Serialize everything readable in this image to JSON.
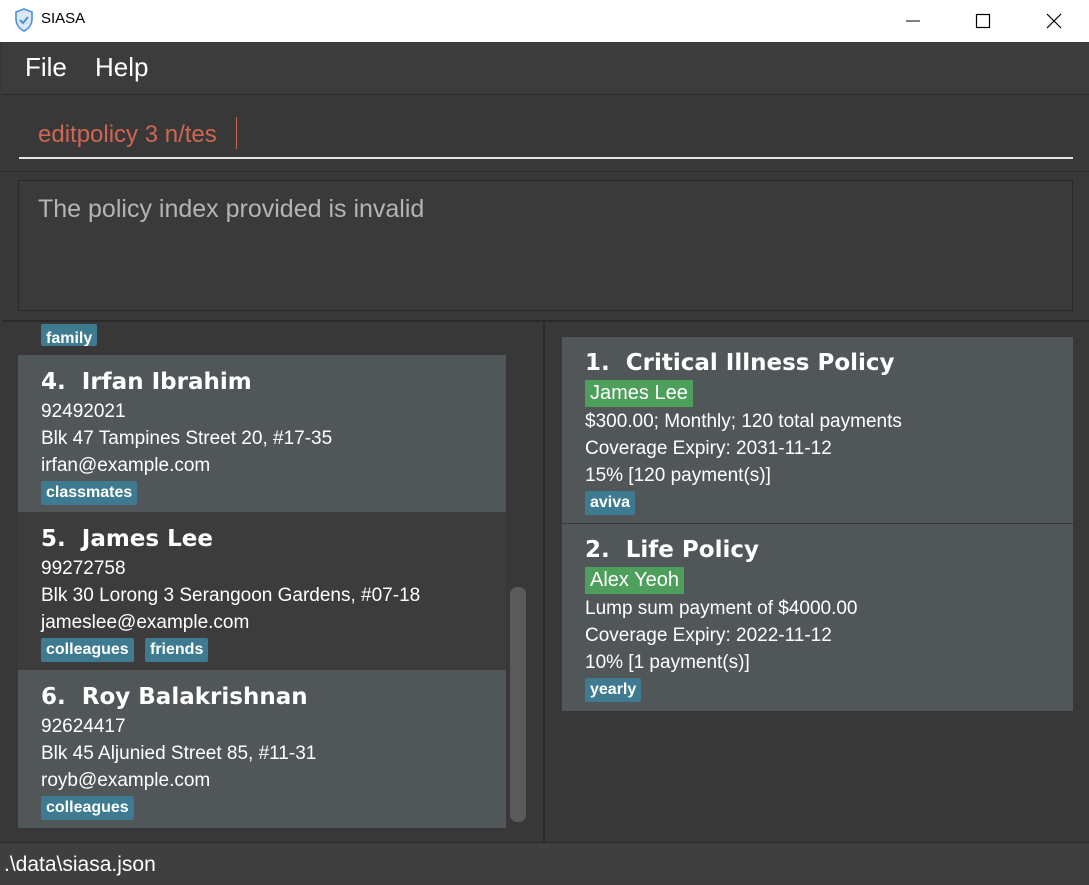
{
  "window": {
    "title": "SIASA"
  },
  "menu": {
    "file": "File",
    "help": "Help"
  },
  "command": {
    "value": "editpolicy 3 n/tes"
  },
  "result": {
    "message": "The policy index provided is invalid"
  },
  "clients": {
    "partial_tag": "family",
    "cards": [
      {
        "index": "4.",
        "name": "Irfan Ibrahim",
        "phone": "92492021",
        "address": "Blk 47 Tampines Street 20, #17-35",
        "email": "irfan@example.com",
        "tags": [
          "classmates"
        ]
      },
      {
        "index": "5.",
        "name": "James Lee",
        "phone": "99272758",
        "address": "Blk 30 Lorong 3 Serangoon Gardens, #07-18",
        "email": "jameslee@example.com",
        "tags": [
          "colleagues",
          "friends"
        ]
      },
      {
        "index": "6.",
        "name": "Roy Balakrishnan",
        "phone": "92624417",
        "address": "Blk 45 Aljunied Street 85, #11-31",
        "email": "royb@example.com",
        "tags": [
          "colleagues"
        ]
      }
    ]
  },
  "policies": {
    "cards": [
      {
        "index": "1.",
        "title": "Critical Illness Policy",
        "owner": "James Lee",
        "payment": "$300.00; Monthly; 120 total payments",
        "expiry": "Coverage Expiry: 2031-11-12",
        "commission": "15% [120 payment(s)]",
        "tags": [
          "aviva"
        ]
      },
      {
        "index": "2.",
        "title": "Life Policy",
        "owner": "Alex Yeoh",
        "payment": "Lump sum payment of $4000.00",
        "expiry": "Coverage Expiry: 2022-11-12",
        "commission": "10% [1 payment(s)]",
        "tags": [
          "yearly"
        ]
      }
    ]
  },
  "status": {
    "path": ".\\data\\siasa.json"
  },
  "colors": {
    "background": "#383838",
    "tag": "#3e7b91",
    "owner_tag": "#4e9f5b",
    "command_text": "#d06651"
  },
  "icons": {
    "app": "shield-check-icon",
    "minimize": "minimize-icon",
    "maximize": "maximize-icon",
    "close": "close-icon"
  }
}
